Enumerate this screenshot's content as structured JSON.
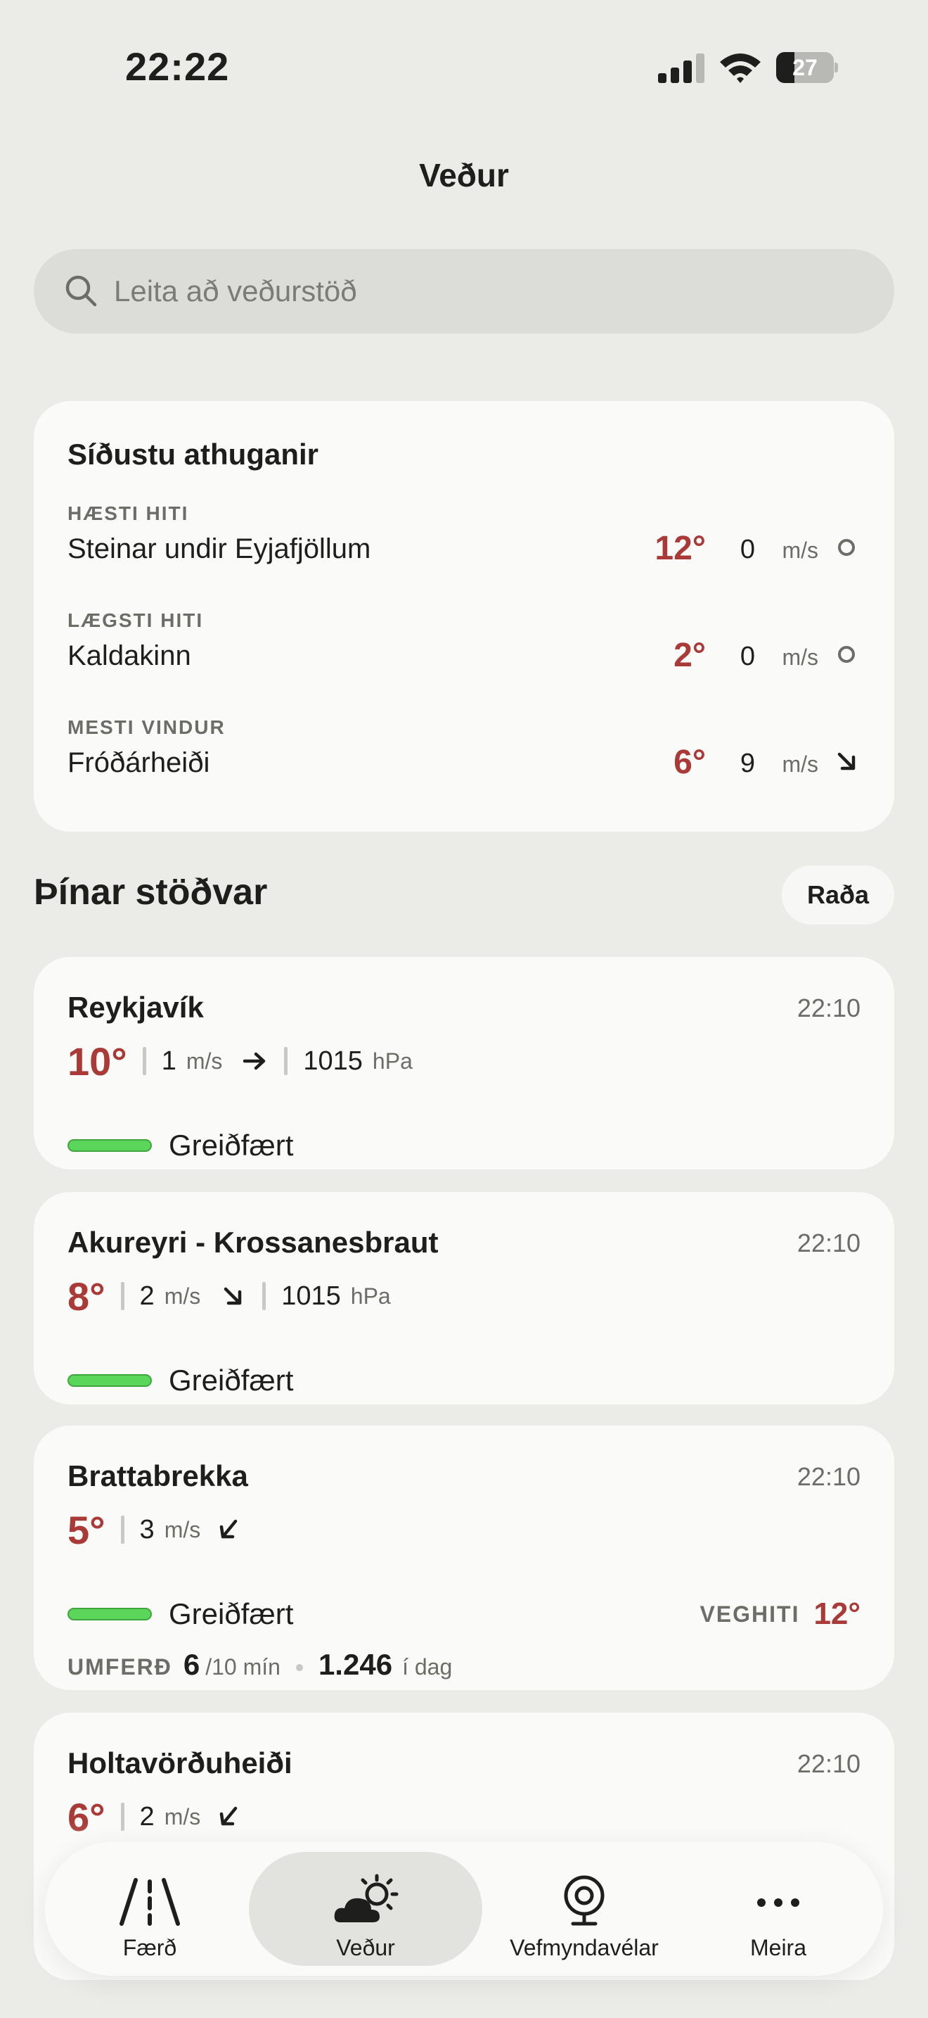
{
  "status_bar": {
    "time": "22:22",
    "battery": "27"
  },
  "header": {
    "title": "Veður"
  },
  "search": {
    "placeholder": "Leita að veðurstöð"
  },
  "observations": {
    "title": "Síðustu athuganir",
    "rows": [
      {
        "category": "HÆSTI HITI",
        "station": "Steinar undir Eyjafjöllum",
        "temp": "12°",
        "wind": "0",
        "unit": "m/s",
        "direction": "calm-circle-icon"
      },
      {
        "category": "LÆGSTI HITI",
        "station": "Kaldakinn",
        "temp": "2°",
        "wind": "0",
        "unit": "m/s",
        "direction": "calm-circle-icon"
      },
      {
        "category": "MESTI VINDUR",
        "station": "Fróðárheiði",
        "temp": "6°",
        "wind": "9",
        "unit": "m/s",
        "direction": "arrow-down-right-icon"
      }
    ]
  },
  "stations_section": {
    "title": "Þínar stöðvar",
    "sort_label": "Raða"
  },
  "stations": [
    {
      "name": "Reykjavík",
      "time": "22:10",
      "temp": "10°",
      "wind": "1",
      "wind_unit": "m/s",
      "direction": "arrow-right-icon",
      "pressure": "1015",
      "pressure_unit": "hPa",
      "condition": "Greiðfært",
      "condition_color": "#5cd65a"
    },
    {
      "name": "Akureyri - Krossanesbraut",
      "time": "22:10",
      "temp": "8°",
      "wind": "2",
      "wind_unit": "m/s",
      "direction": "arrow-down-right-icon",
      "pressure": "1015",
      "pressure_unit": "hPa",
      "condition": "Greiðfært",
      "condition_color": "#5cd65a"
    },
    {
      "name": "Brattabrekka",
      "time": "22:10",
      "temp": "5°",
      "wind": "3",
      "wind_unit": "m/s",
      "direction": "arrow-down-left-icon",
      "condition": "Greiðfært",
      "condition_color": "#5cd65a",
      "road_temp_label": "VEGHITI",
      "road_temp": "12°",
      "traffic_label": "UMFERÐ",
      "traffic_now": "6",
      "traffic_now_unit": "/10 mín",
      "traffic_day": "1.246",
      "traffic_day_unit": "í dag"
    },
    {
      "name": "Holtavörðuheiði",
      "time": "22:10",
      "temp": "6°",
      "wind": "2",
      "wind_unit": "m/s",
      "direction": "arrow-down-left-icon"
    }
  ],
  "tabbar": {
    "tabs": [
      {
        "label": "Færð",
        "icon": "road-icon"
      },
      {
        "label": "Veður",
        "icon": "weather-icon",
        "active": true
      },
      {
        "label": "Vefmyndavélar",
        "icon": "webcam-icon"
      },
      {
        "label": "Meira",
        "icon": "more-icon"
      }
    ]
  },
  "colors": {
    "temp_red": "#a93a38",
    "background": "#ebebe8",
    "card": "#fafaf8",
    "road_good": "#5cd65a"
  }
}
